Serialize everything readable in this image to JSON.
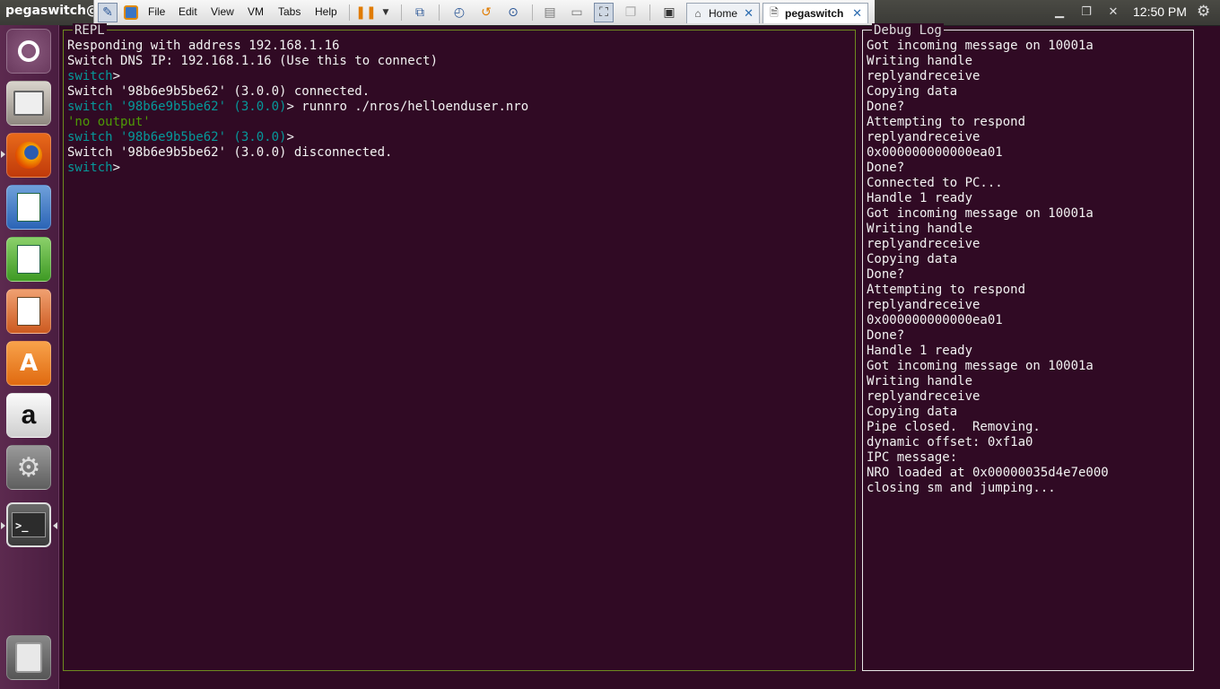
{
  "topbar": {
    "window_title": "pegaswitch@",
    "menus": [
      "File",
      "Edit",
      "View",
      "VM",
      "Tabs",
      "Help"
    ],
    "tabs": [
      {
        "label": "Home",
        "icon": "home-icon",
        "active": false
      },
      {
        "label": "pegaswitch",
        "icon": "vm-icon",
        "active": true
      }
    ],
    "clock": "12:50 PM"
  },
  "launcher": {
    "items": [
      "ubuntu-dash",
      "files",
      "firefox",
      "libreoffice-writer",
      "libreoffice-calc",
      "libreoffice-impress",
      "ubuntu-software",
      "amazon",
      "system-settings",
      "terminal",
      "trash"
    ],
    "amazon_letter": "a",
    "software_letter": "A",
    "terminal_prompt": ">_"
  },
  "repl": {
    "title": "REPL",
    "lines": [
      [
        {
          "t": "Responding with address 192.168.1.16",
          "c": "white"
        }
      ],
      [
        {
          "t": "Switch DNS IP: 192.168.1.16 (Use this to connect)",
          "c": "white"
        }
      ],
      [
        {
          "t": "switch",
          "c": "teal"
        },
        {
          "t": ">",
          "c": "white"
        }
      ],
      [
        {
          "t": "Switch '98b6e9b5be62' (3.0.0) connected.",
          "c": "white"
        }
      ],
      [
        {
          "t": "switch '98b6e9b5be62' (3.0.0)",
          "c": "teal"
        },
        {
          "t": "> runnro ./nros/helloenduser.nro",
          "c": "white"
        }
      ],
      [
        {
          "t": "'no output'",
          "c": "green"
        }
      ],
      [
        {
          "t": "switch '98b6e9b5be62' (3.0.0)",
          "c": "teal"
        },
        {
          "t": ">",
          "c": "white"
        }
      ],
      [
        {
          "t": "Switch '98b6e9b5be62' (3.0.0) disconnected.",
          "c": "white"
        }
      ],
      [
        {
          "t": "switch",
          "c": "teal"
        },
        {
          "t": ">",
          "c": "white"
        }
      ]
    ]
  },
  "debug": {
    "title": "Debug Log",
    "lines": [
      "Got incoming message on 10001a",
      "Writing handle",
      "replyandreceive",
      "Copying data",
      "Done?",
      "Attempting to respond",
      "replyandreceive",
      "0x000000000000ea01",
      "Done?",
      "Connected to PC...",
      "Handle 1 ready",
      "Got incoming message on 10001a",
      "Writing handle",
      "replyandreceive",
      "Copying data",
      "Done?",
      "Attempting to respond",
      "replyandreceive",
      "0x000000000000ea01",
      "Done?",
      "Handle 1 ready",
      "Got incoming message on 10001a",
      "Writing handle",
      "replyandreceive",
      "Copying data",
      "Pipe closed.  Removing.",
      "dynamic offset: 0xf1a0",
      "IPC message:",
      "NRO loaded at 0x00000035d4e7e000",
      "closing sm and jumping..."
    ]
  },
  "colors": {
    "terminal_bg": "#300a24",
    "prompt_teal": "#06989a",
    "output_green": "#4e9a06",
    "repl_border": "#6e8a1f"
  }
}
